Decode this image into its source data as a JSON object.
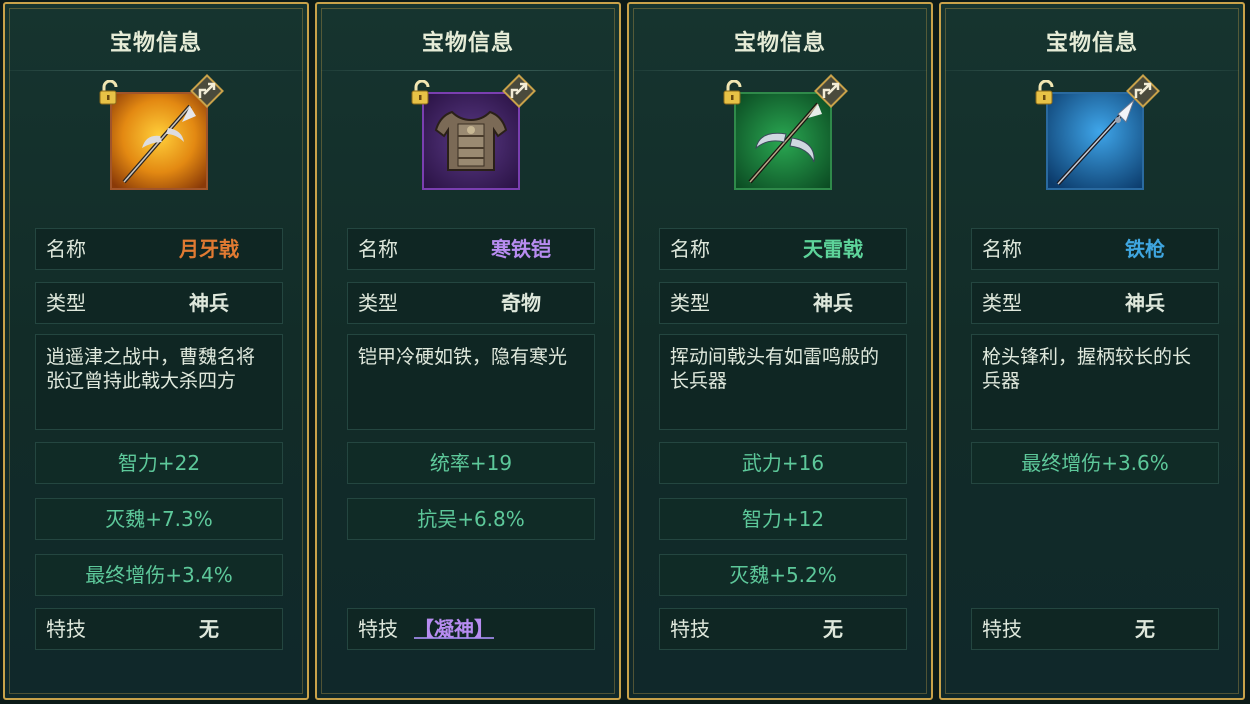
{
  "panels": [
    {
      "title": "宝物信息",
      "icon": "crescent-halberd",
      "accent": "#e07a32",
      "name_label": "名称",
      "name": "月牙戟",
      "type_label": "类型",
      "type": "神兵",
      "description": "逍遥津之战中，曹魏名将张辽曾持此戟大杀四方",
      "stats": [
        "智力+22",
        "灭魏+7.3%",
        "最终增伤+3.4%"
      ],
      "skill_label": "特技",
      "skill": "无"
    },
    {
      "title": "宝物信息",
      "icon": "iron-armor",
      "accent": "#b78cf0",
      "name_label": "名称",
      "name": "寒铁铠",
      "type_label": "类型",
      "type": "奇物",
      "description": "铠甲冷硬如铁，隐有寒光",
      "stats": [
        "统率+19",
        "抗吴+6.8%"
      ],
      "skill_label": "特技",
      "skill": "【凝神】"
    },
    {
      "title": "宝物信息",
      "icon": "thunder-halberd",
      "accent": "#5dd39a",
      "name_label": "名称",
      "name": "天雷戟",
      "type_label": "类型",
      "type": "神兵",
      "description": "挥动间戟头有如雷鸣般的长兵器",
      "stats": [
        "武力+16",
        "智力+12",
        "灭魏+5.2%"
      ],
      "skill_label": "特技",
      "skill": "无"
    },
    {
      "title": "宝物信息",
      "icon": "iron-spear",
      "accent": "#3fa6e0",
      "name_label": "名称",
      "name": "铁枪",
      "type_label": "类型",
      "type": "神兵",
      "description": "枪头锋利，握柄较长的长兵器",
      "stats": [
        "最终增伤+3.6%"
      ],
      "skill_label": "特技",
      "skill": "无"
    }
  ]
}
